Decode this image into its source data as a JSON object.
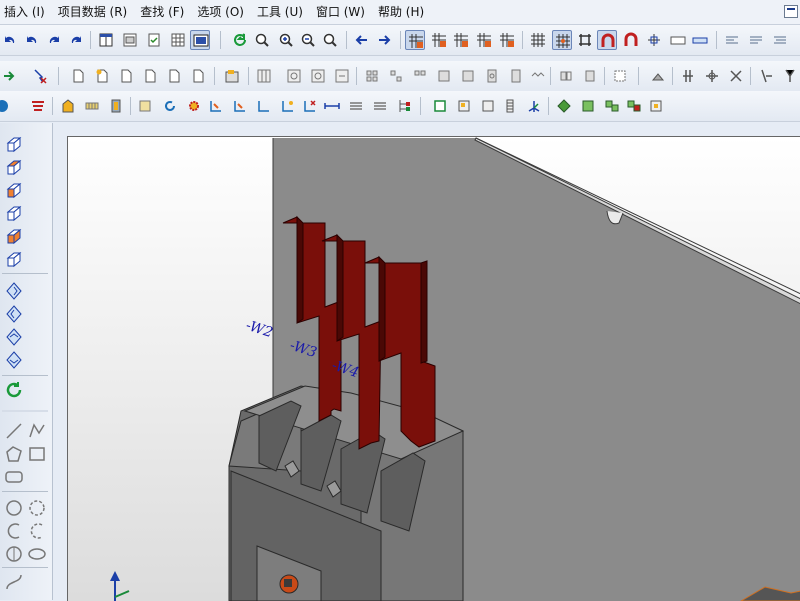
{
  "menu": [
    {
      "label": "插入 (I)"
    },
    {
      "label": "项目数据 (R)"
    },
    {
      "label": "查找 (F)"
    },
    {
      "label": "选项 (O)"
    },
    {
      "label": "工具 (U)"
    },
    {
      "label": "窗口 (W)"
    },
    {
      "label": "帮助 (H)"
    }
  ],
  "viewport": {
    "wire_labels": [
      "-W2",
      "-W3",
      "-W4"
    ],
    "colors": {
      "busbar": "#7a0f0a",
      "wall": "#8a8a8a",
      "device": "#6e6e6e",
      "label": "#1a1aaa"
    }
  },
  "toolbar_icons": {
    "row1": [
      "undo-icon",
      "undo-icon",
      "redo-icon",
      "redo-icon",
      "window-layout-icon",
      "window-list-icon",
      "check-page-icon",
      "table-icon",
      "screen-icon",
      "refresh-icon",
      "zoom-window-icon",
      "zoom-in-icon",
      "zoom-out-icon",
      "zoom-100-icon",
      "arrow-left-icon",
      "arrow-right-icon",
      "grid-a-icon",
      "grid-b-icon",
      "grid-c-icon",
      "grid-d-icon",
      "grid-e-icon",
      "grid-icon",
      "snap-grid-icon",
      "crosshair-icon",
      "magnet-icon",
      "magnet-icon",
      "connection-icon",
      "counter-icon",
      "rectangle-icon",
      "align-icon",
      "align-icon"
    ],
    "row2": [
      "arrow-right-icon",
      "filter-icon",
      "page-icon",
      "new-page-icon",
      "page-icon",
      "page-icon",
      "page-icon",
      "page-icon",
      "device-icon",
      "block-icon",
      "symbol-icon",
      "symbol-icon",
      "symbol-icon",
      "terminal-icon",
      "terminal-icon",
      "terminal-icon",
      "terminal-icon",
      "terminal-icon",
      "wire-icon",
      "connector-icon",
      "connector-icon",
      "frame-icon",
      "measure-icon",
      "line-icon",
      "cross-icon",
      "cross-icon",
      "cross-icon"
    ],
    "row3": [
      "circle-icon",
      "layer-icon",
      "cabinet-icon",
      "rail-icon",
      "duct-icon",
      "mount-icon",
      "rotate-icon",
      "gear-icon",
      "route-icon",
      "route-icon",
      "route-icon",
      "route-icon",
      "dimension-icon",
      "list-icon",
      "tree-icon",
      "box-icon",
      "box-icon",
      "box-icon",
      "rail-icon",
      "axis-icon",
      "cube-icon",
      "cube-icon",
      "cube-icon",
      "cube-icon"
    ]
  },
  "sidebar_icons": [
    "cube-view-icon",
    "cube-view-icon",
    "cube-view-icon",
    "cube-view-icon",
    "cube-view-icon",
    "cube-view-icon",
    "rotate-view-icon",
    "rotate-view-icon",
    "rotate-view-icon",
    "rotate-view-icon",
    "refresh-icon",
    "line-icon",
    "polyline-icon",
    "polygon-icon",
    "rectangle-icon",
    "ellipse-icon",
    "circle-icon",
    "circle-icon",
    "arc-icon",
    "arc-icon",
    "pie-icon",
    "ellipse-icon",
    "spline-icon"
  ]
}
